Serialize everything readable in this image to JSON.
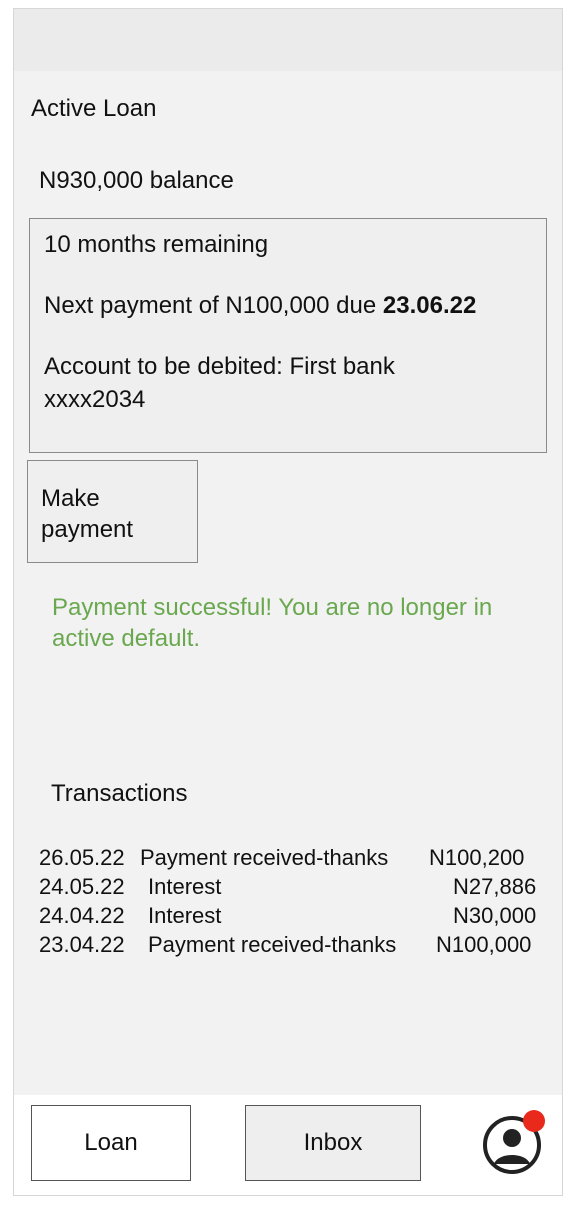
{
  "header": {
    "title": "Active Loan"
  },
  "loan": {
    "balance_text": "N930,000 balance",
    "months_remaining": "10 months remaining",
    "next_payment_prefix": "Next payment of N100,000 due ",
    "next_payment_date": "23.06.22",
    "account_line1": "Account to be debited: First bank",
    "account_line2": "xxxx2034"
  },
  "actions": {
    "make_payment_line1": "Make",
    "make_payment_line2": "payment"
  },
  "message": {
    "success": "Payment successful! You are no longer in active default.",
    "color": "#6aa84f"
  },
  "transactions": {
    "title": "Transactions",
    "rows": [
      {
        "date": "26.05.22",
        "description": "Payment received-thanks",
        "amount": "N100,200"
      },
      {
        "date": "24.05.22",
        "description": "Interest",
        "amount": "N27,886"
      },
      {
        "date": "24.04.22",
        "description": "Interest",
        "amount": "N30,000"
      },
      {
        "date": "23.04.22",
        "description": "Payment received-thanks",
        "amount": "N100,000"
      }
    ]
  },
  "nav": {
    "loan_label": "Loan",
    "inbox_label": "Inbox",
    "profile_icon": "profile-icon",
    "notification_color": "#e8291c"
  }
}
